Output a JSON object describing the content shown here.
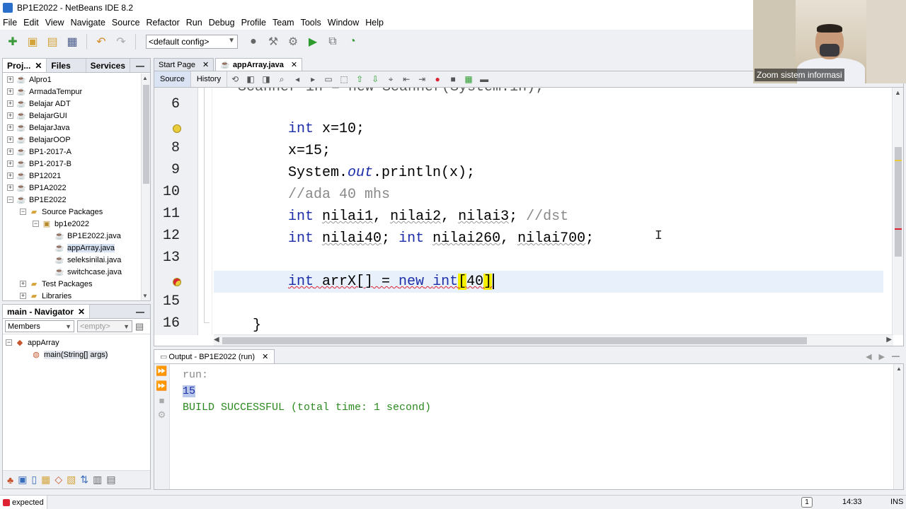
{
  "window": {
    "title": "BP1E2022 - NetBeans IDE 8.2"
  },
  "menu": [
    "File",
    "Edit",
    "View",
    "Navigate",
    "Source",
    "Refactor",
    "Run",
    "Debug",
    "Profile",
    "Team",
    "Tools",
    "Window",
    "Help"
  ],
  "toolbar": {
    "config": "<default config>"
  },
  "projects_panel": {
    "tabs": [
      "Proj...",
      "Files",
      "Services"
    ],
    "tree": [
      {
        "label": "Alpro1",
        "level": 0,
        "icon": "project-icon",
        "expanded": false
      },
      {
        "label": "ArmadaTempur",
        "level": 0,
        "icon": "project-icon",
        "expanded": false
      },
      {
        "label": "Belajar ADT",
        "level": 0,
        "icon": "project-icon",
        "expanded": false
      },
      {
        "label": "BelajarGUI",
        "level": 0,
        "icon": "project-icon",
        "expanded": false
      },
      {
        "label": "BelajarJava",
        "level": 0,
        "icon": "project-icon",
        "expanded": false
      },
      {
        "label": "BelajarOOP",
        "level": 0,
        "icon": "project-icon",
        "expanded": false
      },
      {
        "label": "BP1-2017-A",
        "level": 0,
        "icon": "project-icon",
        "expanded": false
      },
      {
        "label": "BP1-2017-B",
        "level": 0,
        "icon": "project-icon",
        "expanded": false
      },
      {
        "label": "BP12021",
        "level": 0,
        "icon": "project-icon",
        "expanded": false
      },
      {
        "label": "BP1A2022",
        "level": 0,
        "icon": "project-icon",
        "expanded": false
      },
      {
        "label": "BP1E2022",
        "level": 0,
        "icon": "project-icon",
        "expanded": true
      },
      {
        "label": "Source Packages",
        "level": 1,
        "icon": "folder-icon",
        "expanded": true
      },
      {
        "label": "bp1e2022",
        "level": 2,
        "icon": "package-icon",
        "expanded": true
      },
      {
        "label": "BP1E2022.java",
        "level": 3,
        "icon": "java-file-icon"
      },
      {
        "label": "appArray.java",
        "level": 3,
        "icon": "java-file-icon",
        "selected": true
      },
      {
        "label": "seleksinilai.java",
        "level": 3,
        "icon": "java-file-icon"
      },
      {
        "label": "switchcase.java",
        "level": 3,
        "icon": "java-file-icon"
      },
      {
        "label": "Test Packages",
        "level": 1,
        "icon": "folder-icon",
        "expanded": false
      },
      {
        "label": "Libraries",
        "level": 1,
        "icon": "folder-icon",
        "expanded": false
      }
    ]
  },
  "navigator": {
    "title": "main - Navigator",
    "filter": "Members",
    "filter2": "<empty>",
    "class_name": "appArray",
    "method": "main(String[] args)"
  },
  "editor": {
    "tabs": [
      {
        "label": "Start Page",
        "active": false
      },
      {
        "label": "appArray.java",
        "active": true
      }
    ],
    "modes": [
      "Source",
      "History"
    ],
    "line_numbers": [
      "6",
      "",
      "8",
      "9",
      "10",
      "11",
      "12",
      "13",
      "",
      "15",
      "16"
    ],
    "top_partial": "Scanner in = new Scanner(System.in);",
    "lines": {
      "l7_kw": "int",
      "l7_rest": " x=10;",
      "l8": "x=15;",
      "l9_a": "System.",
      "l9_b": "out",
      "l9_c": ".println(x);",
      "l10": "//ada 40 mhs",
      "l11_kw": "int",
      "l11_a": " ",
      "l11_v1": "nilai1",
      "l11_b": ", ",
      "l11_v2": "nilai2",
      "l11_c": ", ",
      "l11_v3": "nilai3",
      "l11_d": "; ",
      "l11_cm": "//dst",
      "l12_kw1": "int",
      "l12_a": " ",
      "l12_v1": "nilai40",
      "l12_b": "; ",
      "l12_kw2": "int",
      "l12_c": " ",
      "l12_v2": "nilai260",
      "l12_d": ", ",
      "l12_v3": "nilai700",
      "l12_e": ";",
      "l14_kw1": "int",
      "l14_a": " arrX[] = ",
      "l14_kw2": "new",
      "l14_b": " ",
      "l14_kw3": "int",
      "l14_br1": "[",
      "l14_num": "40",
      "l14_br2": "]",
      "l16": "}"
    }
  },
  "output": {
    "tab": "Output - BP1E2022 (run)",
    "run": "run:",
    "value": "15",
    "result": "BUILD SUCCESSFUL (total time: 1 second)"
  },
  "status": {
    "message": "expected",
    "badge": "1",
    "position": "14:33",
    "mode": "INS"
  },
  "webcam": {
    "label": "Zoom sistem informasi"
  }
}
